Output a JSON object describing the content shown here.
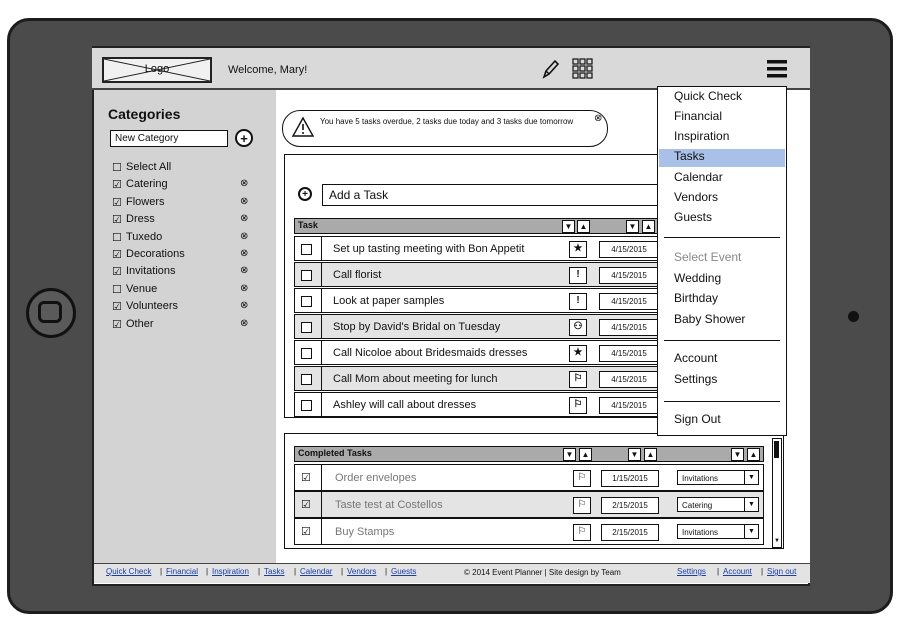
{
  "header": {
    "logo": "Logo",
    "welcome": "Welcome, Mary!",
    "icons": [
      "pencil-icon",
      "grid-icon",
      "hamburger-menu-icon"
    ]
  },
  "sidebar": {
    "title": "Categories",
    "new_category_value": "New Category",
    "items": [
      {
        "label": "Select All",
        "checked": false,
        "removable": false
      },
      {
        "label": "Catering",
        "checked": true,
        "removable": true
      },
      {
        "label": "Flowers",
        "checked": true,
        "removable": true
      },
      {
        "label": "Dress",
        "checked": true,
        "removable": true
      },
      {
        "label": "Tuxedo",
        "checked": false,
        "removable": true
      },
      {
        "label": "Decorations",
        "checked": true,
        "removable": true
      },
      {
        "label": "Invitations",
        "checked": true,
        "removable": true
      },
      {
        "label": "Venue",
        "checked": false,
        "removable": true
      },
      {
        "label": "Volunteers",
        "checked": true,
        "removable": true
      },
      {
        "label": "Other",
        "checked": true,
        "removable": true
      }
    ]
  },
  "alert": {
    "text": "You have 5 tasks overdue, 2 tasks due today and 3 tasks due tomorrow"
  },
  "tasks": {
    "add_placeholder": "Add a Task",
    "header": "Task",
    "rows": [
      {
        "text": "Set up tasting meeting with Bon Appetit",
        "icon": "★",
        "date": "4/15/2015"
      },
      {
        "text": "Call florist",
        "icon": "!",
        "date": "4/15/2015"
      },
      {
        "text": "Look at paper samples",
        "icon": "!",
        "date": "4/15/2015"
      },
      {
        "text": "Stop by David's Bridal on Tuesday",
        "icon": "⚇",
        "date": "4/15/2015"
      },
      {
        "text": "Call Nicoloe about Bridesmaids dresses",
        "icon": "★",
        "date": "4/15/2015"
      },
      {
        "text": "Call Mom about meeting for lunch",
        "icon": "⚐",
        "date": "4/15/2015"
      },
      {
        "text": "Ashley will call about dresses",
        "icon": "⚐",
        "date": "4/15/2015"
      }
    ]
  },
  "completed": {
    "header": "Completed Tasks",
    "rows": [
      {
        "text": "Order envelopes",
        "icon": "⚐",
        "date": "1/15/2015",
        "category": "Invitations"
      },
      {
        "text": "Taste test at Costellos",
        "icon": "⚐",
        "date": "2/15/2015",
        "category": "Catering"
      },
      {
        "text": "Buy Stamps",
        "icon": "⚐",
        "date": "2/15/2015",
        "category": "Invitations"
      }
    ]
  },
  "menu": {
    "group1": [
      "Quick Check",
      "Financial",
      "Inspiration",
      "Tasks",
      "Calendar",
      "Vendors",
      "Guests"
    ],
    "active": "Tasks",
    "select_event_label": "Select Event",
    "events": [
      "Wedding",
      "Birthday",
      "Baby Shower"
    ],
    "group3": [
      "Account",
      "Settings"
    ],
    "sign_out": "Sign Out"
  },
  "footer": {
    "links_left": [
      "Quick Check",
      "Financial",
      "Inspiration",
      "Tasks",
      "Calendar",
      "Vendors",
      "Guests"
    ],
    "copyright": "© 2014 Event Planner | Site design by Team",
    "links_right": [
      "Settings",
      "Account",
      "Sign out"
    ]
  },
  "colors": {
    "active_menu": "#a9c1e8",
    "sidebar_bg": "#d3d3d3",
    "header_bg": "#d9d9d9",
    "link": "#1a3ea8"
  }
}
